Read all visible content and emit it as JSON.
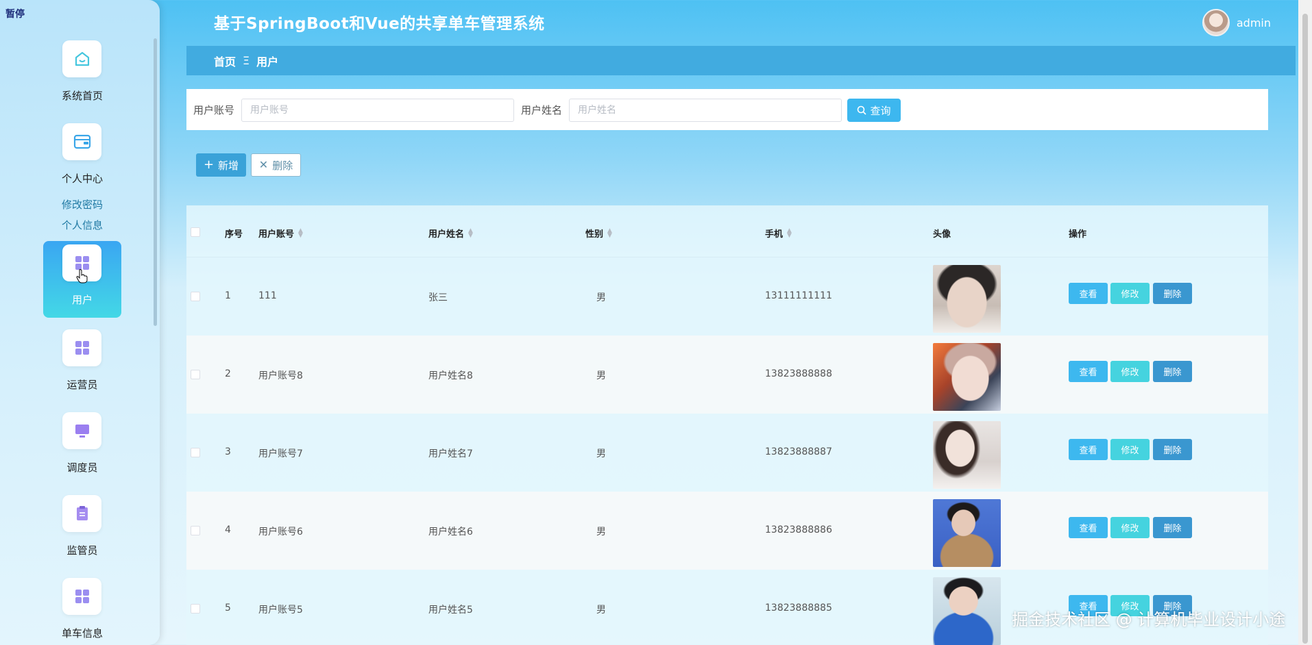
{
  "app": {
    "title": "基于SpringBoot和Vue的共享单车管理系统",
    "pause_label": "暂停",
    "username": "admin"
  },
  "sidebar": {
    "items": [
      {
        "label": "系统首页",
        "icon": "home-icon"
      },
      {
        "label": "个人中心",
        "icon": "wallet-icon"
      },
      {
        "label": "用户",
        "icon": "grid-icon",
        "active": true
      },
      {
        "label": "运营员",
        "icon": "grid-icon"
      },
      {
        "label": "调度员",
        "icon": "monitor-icon"
      },
      {
        "label": "监管员",
        "icon": "clipboard-icon"
      },
      {
        "label": "单车信息",
        "icon": "grid-icon"
      }
    ],
    "sub_items": [
      "修改密码",
      "个人信息"
    ]
  },
  "breadcrumb": {
    "home": "首页",
    "separator": "Ξ",
    "current": "用户"
  },
  "search": {
    "account_label": "用户账号",
    "account_placeholder": "用户账号",
    "name_label": "用户姓名",
    "name_placeholder": "用户姓名",
    "button_label": "查询"
  },
  "actions": {
    "add_label": "新增",
    "delete_label": "删除"
  },
  "table": {
    "columns": [
      "序号",
      "用户账号",
      "用户姓名",
      "性别",
      "手机",
      "头像",
      "操作"
    ],
    "op_labels": {
      "view": "查看",
      "edit": "修改",
      "delete": "删除"
    },
    "rows": [
      {
        "no": "1",
        "account": "111",
        "name": "张三",
        "gender": "男",
        "phone": "13111111111"
      },
      {
        "no": "2",
        "account": "用户账号8",
        "name": "用户姓名8",
        "gender": "男",
        "phone": "13823888888"
      },
      {
        "no": "3",
        "account": "用户账号7",
        "name": "用户姓名7",
        "gender": "男",
        "phone": "13823888887"
      },
      {
        "no": "4",
        "account": "用户账号6",
        "name": "用户姓名6",
        "gender": "男",
        "phone": "13823888886"
      },
      {
        "no": "5",
        "account": "用户账号5",
        "name": "用户姓名5",
        "gender": "男",
        "phone": "13823888885"
      }
    ]
  },
  "watermark": "掘金技术社区 @ 计算机毕业设计小途",
  "colors": {
    "accent": "#3db8ef",
    "breadcrumb_bg": "#41abe0",
    "active_menu_top": "#3aa6f2",
    "active_menu_bottom": "#43d8e6",
    "edit_button": "#45d3df",
    "delete_button": "#3a97d0"
  }
}
